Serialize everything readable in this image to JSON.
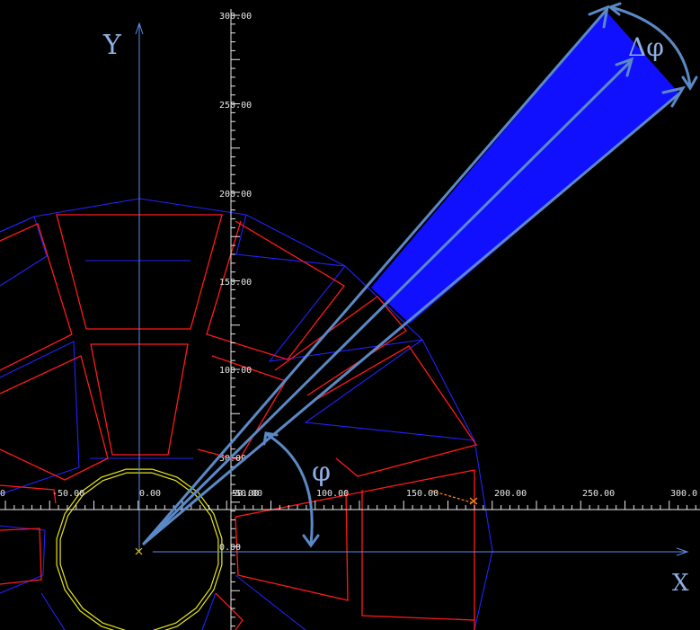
{
  "labels": {
    "y_axis": "Y",
    "x_axis": "X",
    "phi": "φ",
    "delta_phi": "Δφ"
  },
  "axis_ticks": {
    "x": [
      "-50.00",
      "0.00",
      "100.00",
      "150.00",
      "200.00",
      "250.00",
      "300.0"
    ],
    "y": [
      "300.00",
      "250.00",
      "200.00",
      "150.00",
      "100.00",
      "50.00"
    ],
    "overlap_text": "50.00",
    "zero_text": "0.00",
    "left_edge_text": "0"
  },
  "colors": {
    "background": "#000000",
    "outline_blue": "#2222ff",
    "pole_red": "#ff1a1a",
    "shaft_yellow": "#e6e61a",
    "axis_blue": "#5a8ee8",
    "ruler_white": "#e8e8e8",
    "arrow_steelblue": "#5b89c6",
    "wedge_fill": "#1010ff",
    "origin_marker": "#e6c81a",
    "orange_mark": "#ff9020"
  },
  "icons": {
    "origin": "origin-cross-icon",
    "phi_arrow": "curved-double-arrow-icon",
    "delta_phi_arrow": "curved-double-arrow-icon"
  }
}
